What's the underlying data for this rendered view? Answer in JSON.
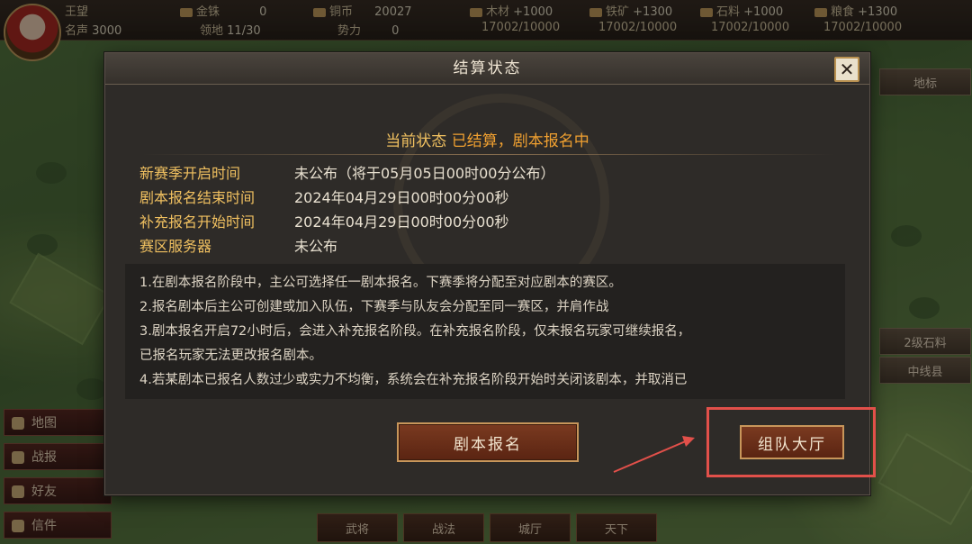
{
  "topbar": {
    "row1": [
      {
        "label": "王望",
        "value": "",
        "icon": "flag-icon"
      },
      {
        "label": "金铢",
        "value": "0",
        "icon": "gold-icon"
      },
      {
        "label": "铜币",
        "value": "20027",
        "icon": "copper-icon"
      },
      {
        "label": "木材",
        "value": "+1000",
        "icon": "wood-icon"
      },
      {
        "label": "铁矿",
        "value": "+1300",
        "icon": "iron-icon"
      },
      {
        "label": "石料",
        "value": "+1000",
        "icon": "stone-icon"
      },
      {
        "label": "粮食",
        "value": "+1300",
        "icon": "grain-icon"
      }
    ],
    "row2": [
      {
        "label": "名声",
        "value": "3000"
      },
      {
        "label": "领地",
        "value": "11/30"
      },
      {
        "label": "势力",
        "value": "0"
      },
      {
        "label": "",
        "value": "17002/10000"
      },
      {
        "label": "",
        "value": "17002/10000"
      },
      {
        "label": "",
        "value": "17002/10000"
      },
      {
        "label": "",
        "value": "17002/10000"
      }
    ]
  },
  "left_menu": [
    "地图",
    "战报",
    "好友",
    "信件"
  ],
  "bottom_tabs": [
    "武将",
    "战法",
    "城厅",
    "天下"
  ],
  "right_menu": [
    "地标",
    "2级石料",
    "中线县"
  ],
  "dialog": {
    "title": "结算状态",
    "close_symbol": "✕",
    "status_prefix": "当前状态",
    "status_value": "已结算，剧本报名中",
    "info": [
      {
        "key": "新赛季开启时间",
        "value": "未公布（将于05月05日00时00分公布）"
      },
      {
        "key": "剧本报名结束时间",
        "value": "2024年04月29日00时00分00秒"
      },
      {
        "key": "补充报名开始时间",
        "value": "2024年04月29日00时00分00秒"
      },
      {
        "key": "赛区服务器",
        "value": "未公布"
      }
    ],
    "rules": [
      "1.在剧本报名阶段中，主公可选择任一剧本报名。下赛季将分配至对应剧本的赛区。",
      "2.报名剧本后主公可创建或加入队伍，下赛季与队友会分配至同一赛区，并肩作战",
      "3.剧本报名开启72小时后，会进入补充报名阶段。在补充报名阶段，仅未报名玩家可继续报名，",
      "已报名玩家无法更改报名剧本。",
      "4.若某剧本已报名人数过少或实力不均衡，系统会在补充报名阶段开始时关闭该剧本，并取消已"
    ],
    "signup_button": "剧本报名",
    "team_button": "组队大厅"
  },
  "colors": {
    "accent": "#f0c060",
    "highlight": "#e2504a",
    "button": "#7a3a20"
  }
}
